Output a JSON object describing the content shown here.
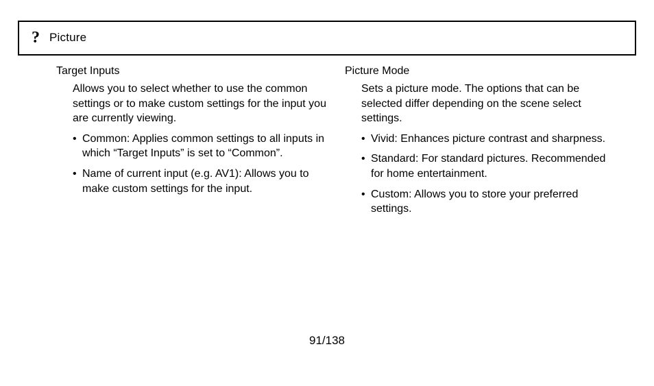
{
  "header": {
    "icon_name": "question-mark-icon",
    "title": "Picture"
  },
  "columns": {
    "left": {
      "title": "Target Inputs",
      "description": "Allows you to select whether to use the common settings or to make custom settings for the input you are currently viewing.",
      "items": [
        "Common: Applies common settings to all inputs in which “Target Inputs” is set to “Common”.",
        "Name of current input (e.g. AV1): Allows you to make custom settings for the input."
      ]
    },
    "right": {
      "title": "Picture Mode",
      "description": "Sets a picture mode. The options that can be selected differ depending on the scene select settings.",
      "items": [
        "Vivid: Enhances picture contrast and sharpness.",
        "Standard: For standard pictures. Recommended for home entertainment.",
        "Custom: Allows you to store your preferred settings."
      ]
    }
  },
  "pager": {
    "text": "91/138"
  }
}
